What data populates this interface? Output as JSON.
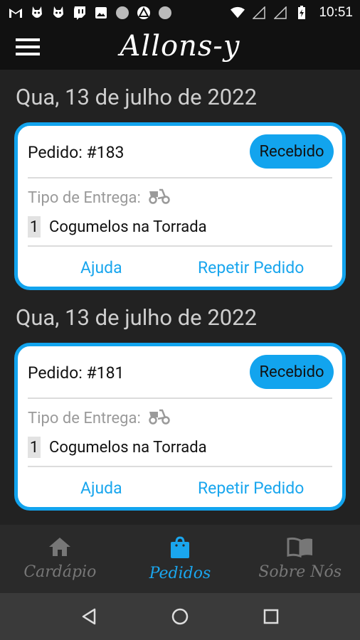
{
  "status_bar": {
    "time": "10:51",
    "left_icons": [
      "gmail-icon",
      "app-icon-1",
      "app-icon-2",
      "twitch-icon",
      "image-icon",
      "circle-icon",
      "app-icon-3",
      "circle-icon-2"
    ],
    "right_icons": [
      "wifi-icon",
      "signal-icon",
      "signal-icon-2",
      "battery-icon"
    ]
  },
  "app_bar": {
    "title": "Allons-y",
    "menu_icon": "menu-icon"
  },
  "orders": [
    {
      "date": "Qua, 13 de julho de 2022",
      "order_label": "Pedido: #183",
      "status": "Recebido",
      "delivery_label": "Tipo de Entrega:",
      "delivery_icon": "scooter-icon",
      "quantity": "1",
      "item": "Cogumelos na Torrada",
      "help_label": "Ajuda",
      "repeat_label": "Repetir Pedido"
    },
    {
      "date": "Qua, 13 de julho de 2022",
      "order_label": "Pedido: #181",
      "status": "Recebido",
      "delivery_label": "Tipo de Entrega:",
      "delivery_icon": "scooter-icon",
      "quantity": "1",
      "item": "Cogumelos na Torrada",
      "help_label": "Ajuda",
      "repeat_label": "Repetir Pedido"
    }
  ],
  "bottom_nav": [
    {
      "label": "Cardápio",
      "icon": "home-icon",
      "active": false
    },
    {
      "label": "Pedidos",
      "icon": "shopping-bag-icon",
      "active": true
    },
    {
      "label": "Sobre Nós",
      "icon": "book-icon",
      "active": false
    }
  ],
  "colors": {
    "accent": "#12a4ee",
    "background": "#222222",
    "app_bar": "#111111",
    "nav_inactive": "#777777"
  }
}
